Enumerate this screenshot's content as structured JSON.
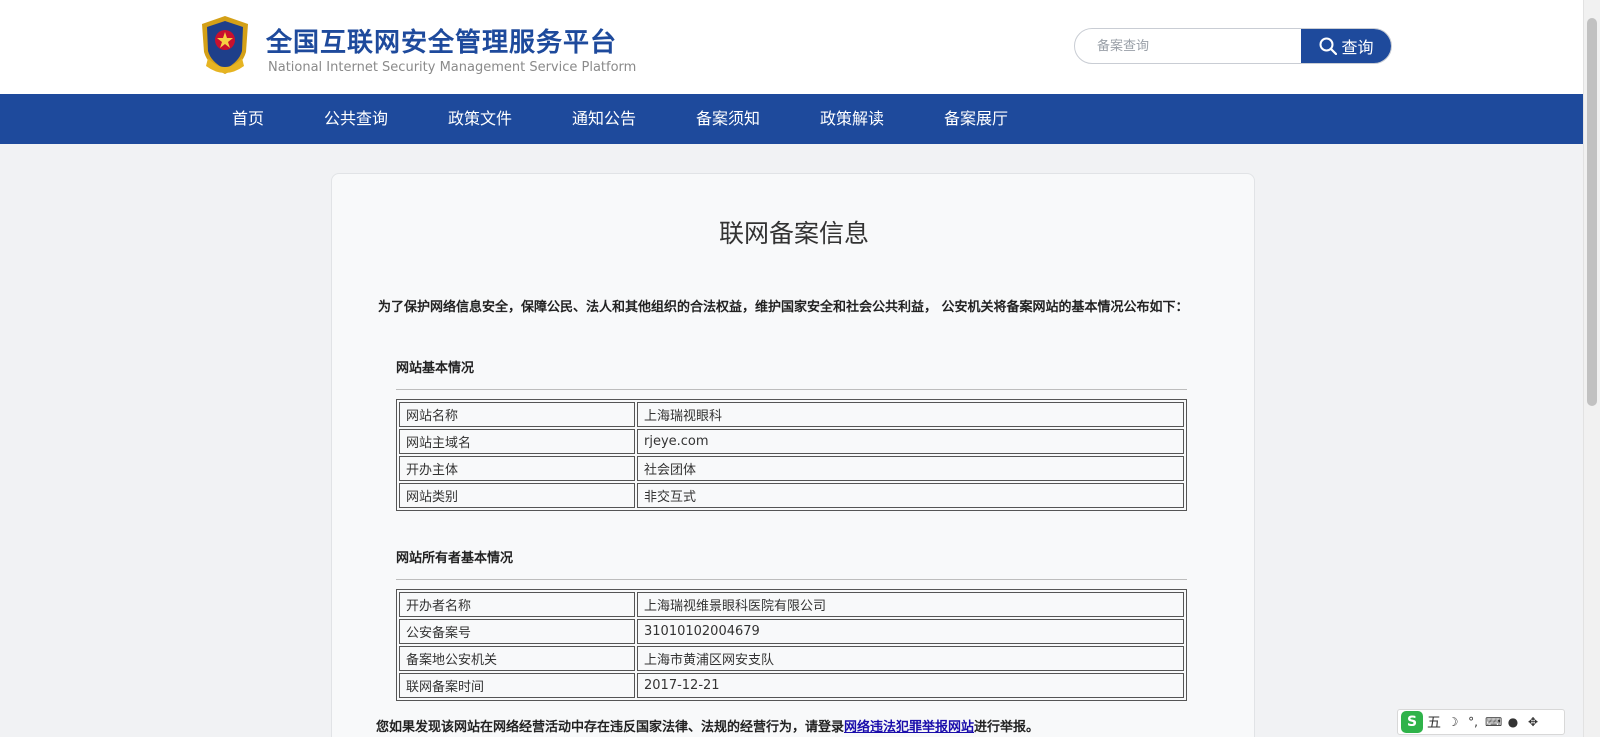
{
  "header": {
    "title": "全国互联网安全管理服务平台",
    "subtitle": "National Internet Security Management Service Platform",
    "search_placeholder": "备案查询",
    "search_button": "查询"
  },
  "nav": {
    "items": [
      "首页",
      "公共查询",
      "政策文件",
      "通知公告",
      "备案须知",
      "政策解读",
      "备案展厅"
    ]
  },
  "main": {
    "title": "联网备案信息",
    "intro": "为了保护网络信息安全，保障公民、法人和其他组织的合法权益，维护国家安全和社会公共利益， 公安机关将备案网站的基本情况公布如下：",
    "section1": {
      "heading": "网站基本情况",
      "rows": [
        {
          "key": "网站名称",
          "value": "上海瑞视眼科"
        },
        {
          "key": "网站主域名",
          "value": "rjeye.com"
        },
        {
          "key": "开办主体",
          "value": "社会团体"
        },
        {
          "key": "网站类别",
          "value": "非交互式"
        }
      ]
    },
    "section2": {
      "heading": "网站所有者基本情况",
      "rows": [
        {
          "key": "开办者名称",
          "value": "上海瑞视维景眼科医院有限公司"
        },
        {
          "key": "公安备案号",
          "value": "31010102004679"
        },
        {
          "key": "备案地公安机关",
          "value": "上海市黄浦区网安支队"
        },
        {
          "key": "联网备案时间",
          "value": "2017-12-21"
        }
      ]
    },
    "report": {
      "prefix": "您如果发现该网站在网络经营活动中存在违反国家法律、法规的经营行为，请登录",
      "link": "网络违法犯罪举报网站",
      "suffix": "进行举报。"
    }
  },
  "ime": {
    "logo": "S",
    "mode": "五"
  },
  "colors": {
    "brand_blue": "#1e4a9c",
    "link_blue": "#1a0dab"
  }
}
